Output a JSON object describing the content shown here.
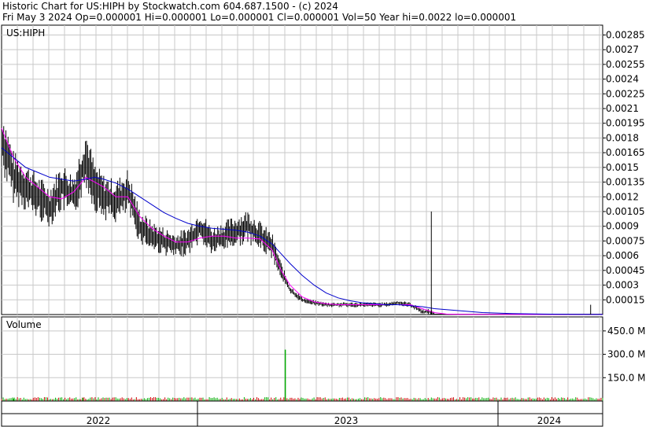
{
  "header": {
    "line1": "Historic Chart for US:HIPH by Stockwatch.com 604.687.1500 - (c) 2024",
    "line2": "Fri May  3 2024   Op=0.000001   Hi=0.000001   Lo=0.000001   Cl=0.000001   Vol=50   Year hi=0.0022   lo=0.000001"
  },
  "colors": {
    "price_bar": "#000000",
    "ma_short": "#ff00ff",
    "ma_long": "#0000cc",
    "volume_up": "#00aa00",
    "volume_down": "#cc0000",
    "grid": "#c8c8c8",
    "panel_bg": "#ffffff"
  },
  "chart_data": [
    {
      "type": "line",
      "title": "US:HIPH",
      "ylabel": "",
      "ylim": [
        0,
        0.00295
      ],
      "y_ticks": [
        "0.00015",
        "0.0003",
        "0.00045",
        "0.0006",
        "0.00075",
        "0.0009",
        "0.00105",
        "0.0012",
        "0.00135",
        "0.0015",
        "0.00165",
        "0.0018",
        "0.00195",
        "0.0021",
        "0.00225",
        "0.0024",
        "0.00255",
        "0.0027",
        "0.00285"
      ],
      "y_tick_values": [
        0.00015,
        0.0003,
        0.00045,
        0.0006,
        0.00075,
        0.0009,
        0.00105,
        0.0012,
        0.00135,
        0.0015,
        0.00165,
        0.0018,
        0.00195,
        0.0021,
        0.00225,
        0.0024,
        0.00255,
        0.0027,
        0.00285
      ],
      "x": [
        0.0,
        0.02,
        0.04,
        0.06,
        0.08,
        0.1,
        0.12,
        0.14,
        0.155,
        0.17,
        0.19,
        0.21,
        0.23,
        0.25,
        0.27,
        0.29,
        0.31,
        0.33,
        0.35,
        0.37,
        0.39,
        0.41,
        0.43,
        0.45,
        0.465,
        0.48,
        0.5,
        0.52,
        0.54,
        0.56,
        0.58,
        0.6,
        0.62,
        0.64,
        0.66,
        0.68,
        0.7,
        0.71,
        0.72,
        0.74,
        0.76,
        0.78,
        0.8,
        0.85,
        0.9,
        0.95,
        1.0
      ],
      "series": [
        {
          "name": "",
          "values": [
            0.0018,
            0.0014,
            0.0013,
            0.0012,
            0.0011,
            0.0013,
            0.0012,
            0.0016,
            0.0013,
            0.0012,
            0.00115,
            0.00125,
            0.0009,
            0.0008,
            0.00075,
            0.0007,
            0.00075,
            0.0009,
            0.00075,
            0.0008,
            0.00085,
            0.0009,
            0.0008,
            0.0007,
            0.00045,
            0.00025,
            0.00015,
            0.00012,
            0.0001,
            0.0001,
            0.0001,
            0.0001,
            0.0001,
            0.0001,
            0.00012,
            0.0001,
            3e-05,
            3e-05,
            1e-05,
            1e-06,
            1e-06,
            1e-06,
            1e-06,
            1e-06,
            1e-06,
            1e-06,
            1e-06
          ]
        },
        {
          "name": "",
          "values": [
            0.0019,
            0.0016,
            0.0014,
            0.0013,
            0.0012,
            0.00118,
            0.00125,
            0.0014,
            0.00135,
            0.0013,
            0.0012,
            0.0012,
            0.001,
            0.00088,
            0.0008,
            0.00074,
            0.00074,
            0.00078,
            0.0008,
            0.0008,
            0.00078,
            0.00078,
            0.00077,
            0.00066,
            0.00045,
            0.0003,
            0.00018,
            0.00013,
            0.00011,
            0.0001,
            0.0001,
            0.0001,
            0.0001,
            0.0001,
            0.0001,
            0.0001,
            6e-05,
            4e-05,
            2e-05,
            5e-06,
            2e-06,
            1e-06,
            1e-06,
            1e-06,
            1e-06,
            1e-06,
            1e-06
          ]
        },
        {
          "name": "",
          "values": [
            0.0017,
            0.0016,
            0.0015,
            0.00145,
            0.0014,
            0.00138,
            0.00136,
            0.00138,
            0.0014,
            0.00138,
            0.00134,
            0.00128,
            0.0012,
            0.00112,
            0.00104,
            0.00098,
            0.00093,
            0.0009,
            0.00088,
            0.00087,
            0.00086,
            0.00084,
            0.0008,
            0.00072,
            0.00062,
            0.00052,
            0.0004,
            0.0003,
            0.00022,
            0.00017,
            0.00014,
            0.00012,
            0.00011,
            0.0001,
            0.0001,
            9e-05,
            8e-05,
            7e-05,
            6e-05,
            5e-05,
            4e-05,
            3e-05,
            2e-05,
            1e-05,
            5e-06,
            2e-06,
            1e-06
          ]
        }
      ],
      "spikes": [
        {
          "x": 0.715,
          "high": 0.00105,
          "low": 0.0
        },
        {
          "x": 0.98,
          "high": 0.0001,
          "low": 0.0
        }
      ]
    },
    {
      "type": "bar",
      "title": "Volume",
      "ylabel": "",
      "ylim": [
        0,
        540000000
      ],
      "y_ticks": [
        "150.0 M",
        "300.0 M",
        "450.0 M"
      ],
      "y_tick_values": [
        150000000,
        300000000,
        450000000
      ],
      "x_ticks": [
        "2022",
        "2023",
        "2024"
      ],
      "values_note_x": [
        0.472,
        0.135,
        0.02
      ],
      "values": [
        330000000,
        20000000,
        15000000
      ]
    }
  ]
}
